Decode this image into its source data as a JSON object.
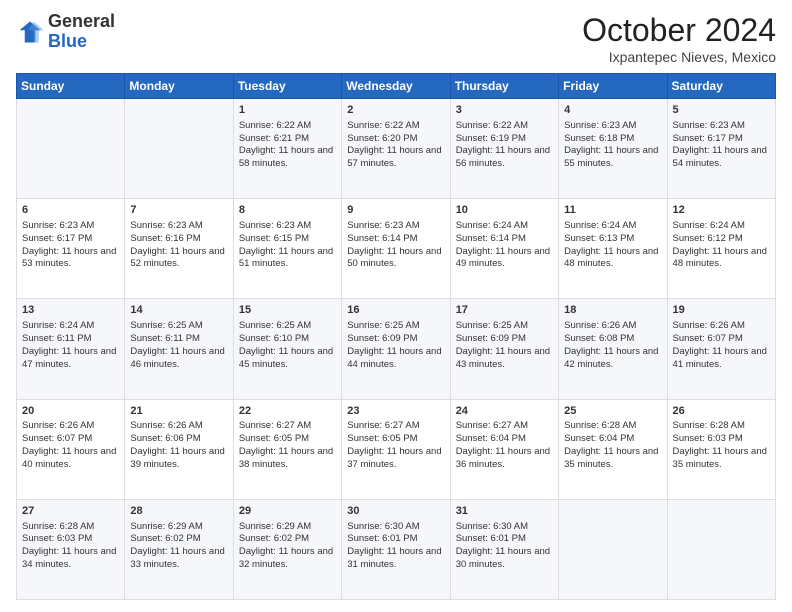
{
  "logo": {
    "general": "General",
    "blue": "Blue"
  },
  "header": {
    "month": "October 2024",
    "location": "Ixpantepec Nieves, Mexico"
  },
  "weekdays": [
    "Sunday",
    "Monday",
    "Tuesday",
    "Wednesday",
    "Thursday",
    "Friday",
    "Saturday"
  ],
  "weeks": [
    [
      {
        "day": "",
        "info": ""
      },
      {
        "day": "",
        "info": ""
      },
      {
        "day": "1",
        "info": "Sunrise: 6:22 AM\nSunset: 6:21 PM\nDaylight: 11 hours and 58 minutes."
      },
      {
        "day": "2",
        "info": "Sunrise: 6:22 AM\nSunset: 6:20 PM\nDaylight: 11 hours and 57 minutes."
      },
      {
        "day": "3",
        "info": "Sunrise: 6:22 AM\nSunset: 6:19 PM\nDaylight: 11 hours and 56 minutes."
      },
      {
        "day": "4",
        "info": "Sunrise: 6:23 AM\nSunset: 6:18 PM\nDaylight: 11 hours and 55 minutes."
      },
      {
        "day": "5",
        "info": "Sunrise: 6:23 AM\nSunset: 6:17 PM\nDaylight: 11 hours and 54 minutes."
      }
    ],
    [
      {
        "day": "6",
        "info": "Sunrise: 6:23 AM\nSunset: 6:17 PM\nDaylight: 11 hours and 53 minutes."
      },
      {
        "day": "7",
        "info": "Sunrise: 6:23 AM\nSunset: 6:16 PM\nDaylight: 11 hours and 52 minutes."
      },
      {
        "day": "8",
        "info": "Sunrise: 6:23 AM\nSunset: 6:15 PM\nDaylight: 11 hours and 51 minutes."
      },
      {
        "day": "9",
        "info": "Sunrise: 6:23 AM\nSunset: 6:14 PM\nDaylight: 11 hours and 50 minutes."
      },
      {
        "day": "10",
        "info": "Sunrise: 6:24 AM\nSunset: 6:14 PM\nDaylight: 11 hours and 49 minutes."
      },
      {
        "day": "11",
        "info": "Sunrise: 6:24 AM\nSunset: 6:13 PM\nDaylight: 11 hours and 48 minutes."
      },
      {
        "day": "12",
        "info": "Sunrise: 6:24 AM\nSunset: 6:12 PM\nDaylight: 11 hours and 48 minutes."
      }
    ],
    [
      {
        "day": "13",
        "info": "Sunrise: 6:24 AM\nSunset: 6:11 PM\nDaylight: 11 hours and 47 minutes."
      },
      {
        "day": "14",
        "info": "Sunrise: 6:25 AM\nSunset: 6:11 PM\nDaylight: 11 hours and 46 minutes."
      },
      {
        "day": "15",
        "info": "Sunrise: 6:25 AM\nSunset: 6:10 PM\nDaylight: 11 hours and 45 minutes."
      },
      {
        "day": "16",
        "info": "Sunrise: 6:25 AM\nSunset: 6:09 PM\nDaylight: 11 hours and 44 minutes."
      },
      {
        "day": "17",
        "info": "Sunrise: 6:25 AM\nSunset: 6:09 PM\nDaylight: 11 hours and 43 minutes."
      },
      {
        "day": "18",
        "info": "Sunrise: 6:26 AM\nSunset: 6:08 PM\nDaylight: 11 hours and 42 minutes."
      },
      {
        "day": "19",
        "info": "Sunrise: 6:26 AM\nSunset: 6:07 PM\nDaylight: 11 hours and 41 minutes."
      }
    ],
    [
      {
        "day": "20",
        "info": "Sunrise: 6:26 AM\nSunset: 6:07 PM\nDaylight: 11 hours and 40 minutes."
      },
      {
        "day": "21",
        "info": "Sunrise: 6:26 AM\nSunset: 6:06 PM\nDaylight: 11 hours and 39 minutes."
      },
      {
        "day": "22",
        "info": "Sunrise: 6:27 AM\nSunset: 6:05 PM\nDaylight: 11 hours and 38 minutes."
      },
      {
        "day": "23",
        "info": "Sunrise: 6:27 AM\nSunset: 6:05 PM\nDaylight: 11 hours and 37 minutes."
      },
      {
        "day": "24",
        "info": "Sunrise: 6:27 AM\nSunset: 6:04 PM\nDaylight: 11 hours and 36 minutes."
      },
      {
        "day": "25",
        "info": "Sunrise: 6:28 AM\nSunset: 6:04 PM\nDaylight: 11 hours and 35 minutes."
      },
      {
        "day": "26",
        "info": "Sunrise: 6:28 AM\nSunset: 6:03 PM\nDaylight: 11 hours and 35 minutes."
      }
    ],
    [
      {
        "day": "27",
        "info": "Sunrise: 6:28 AM\nSunset: 6:03 PM\nDaylight: 11 hours and 34 minutes."
      },
      {
        "day": "28",
        "info": "Sunrise: 6:29 AM\nSunset: 6:02 PM\nDaylight: 11 hours and 33 minutes."
      },
      {
        "day": "29",
        "info": "Sunrise: 6:29 AM\nSunset: 6:02 PM\nDaylight: 11 hours and 32 minutes."
      },
      {
        "day": "30",
        "info": "Sunrise: 6:30 AM\nSunset: 6:01 PM\nDaylight: 11 hours and 31 minutes."
      },
      {
        "day": "31",
        "info": "Sunrise: 6:30 AM\nSunset: 6:01 PM\nDaylight: 11 hours and 30 minutes."
      },
      {
        "day": "",
        "info": ""
      },
      {
        "day": "",
        "info": ""
      }
    ]
  ]
}
